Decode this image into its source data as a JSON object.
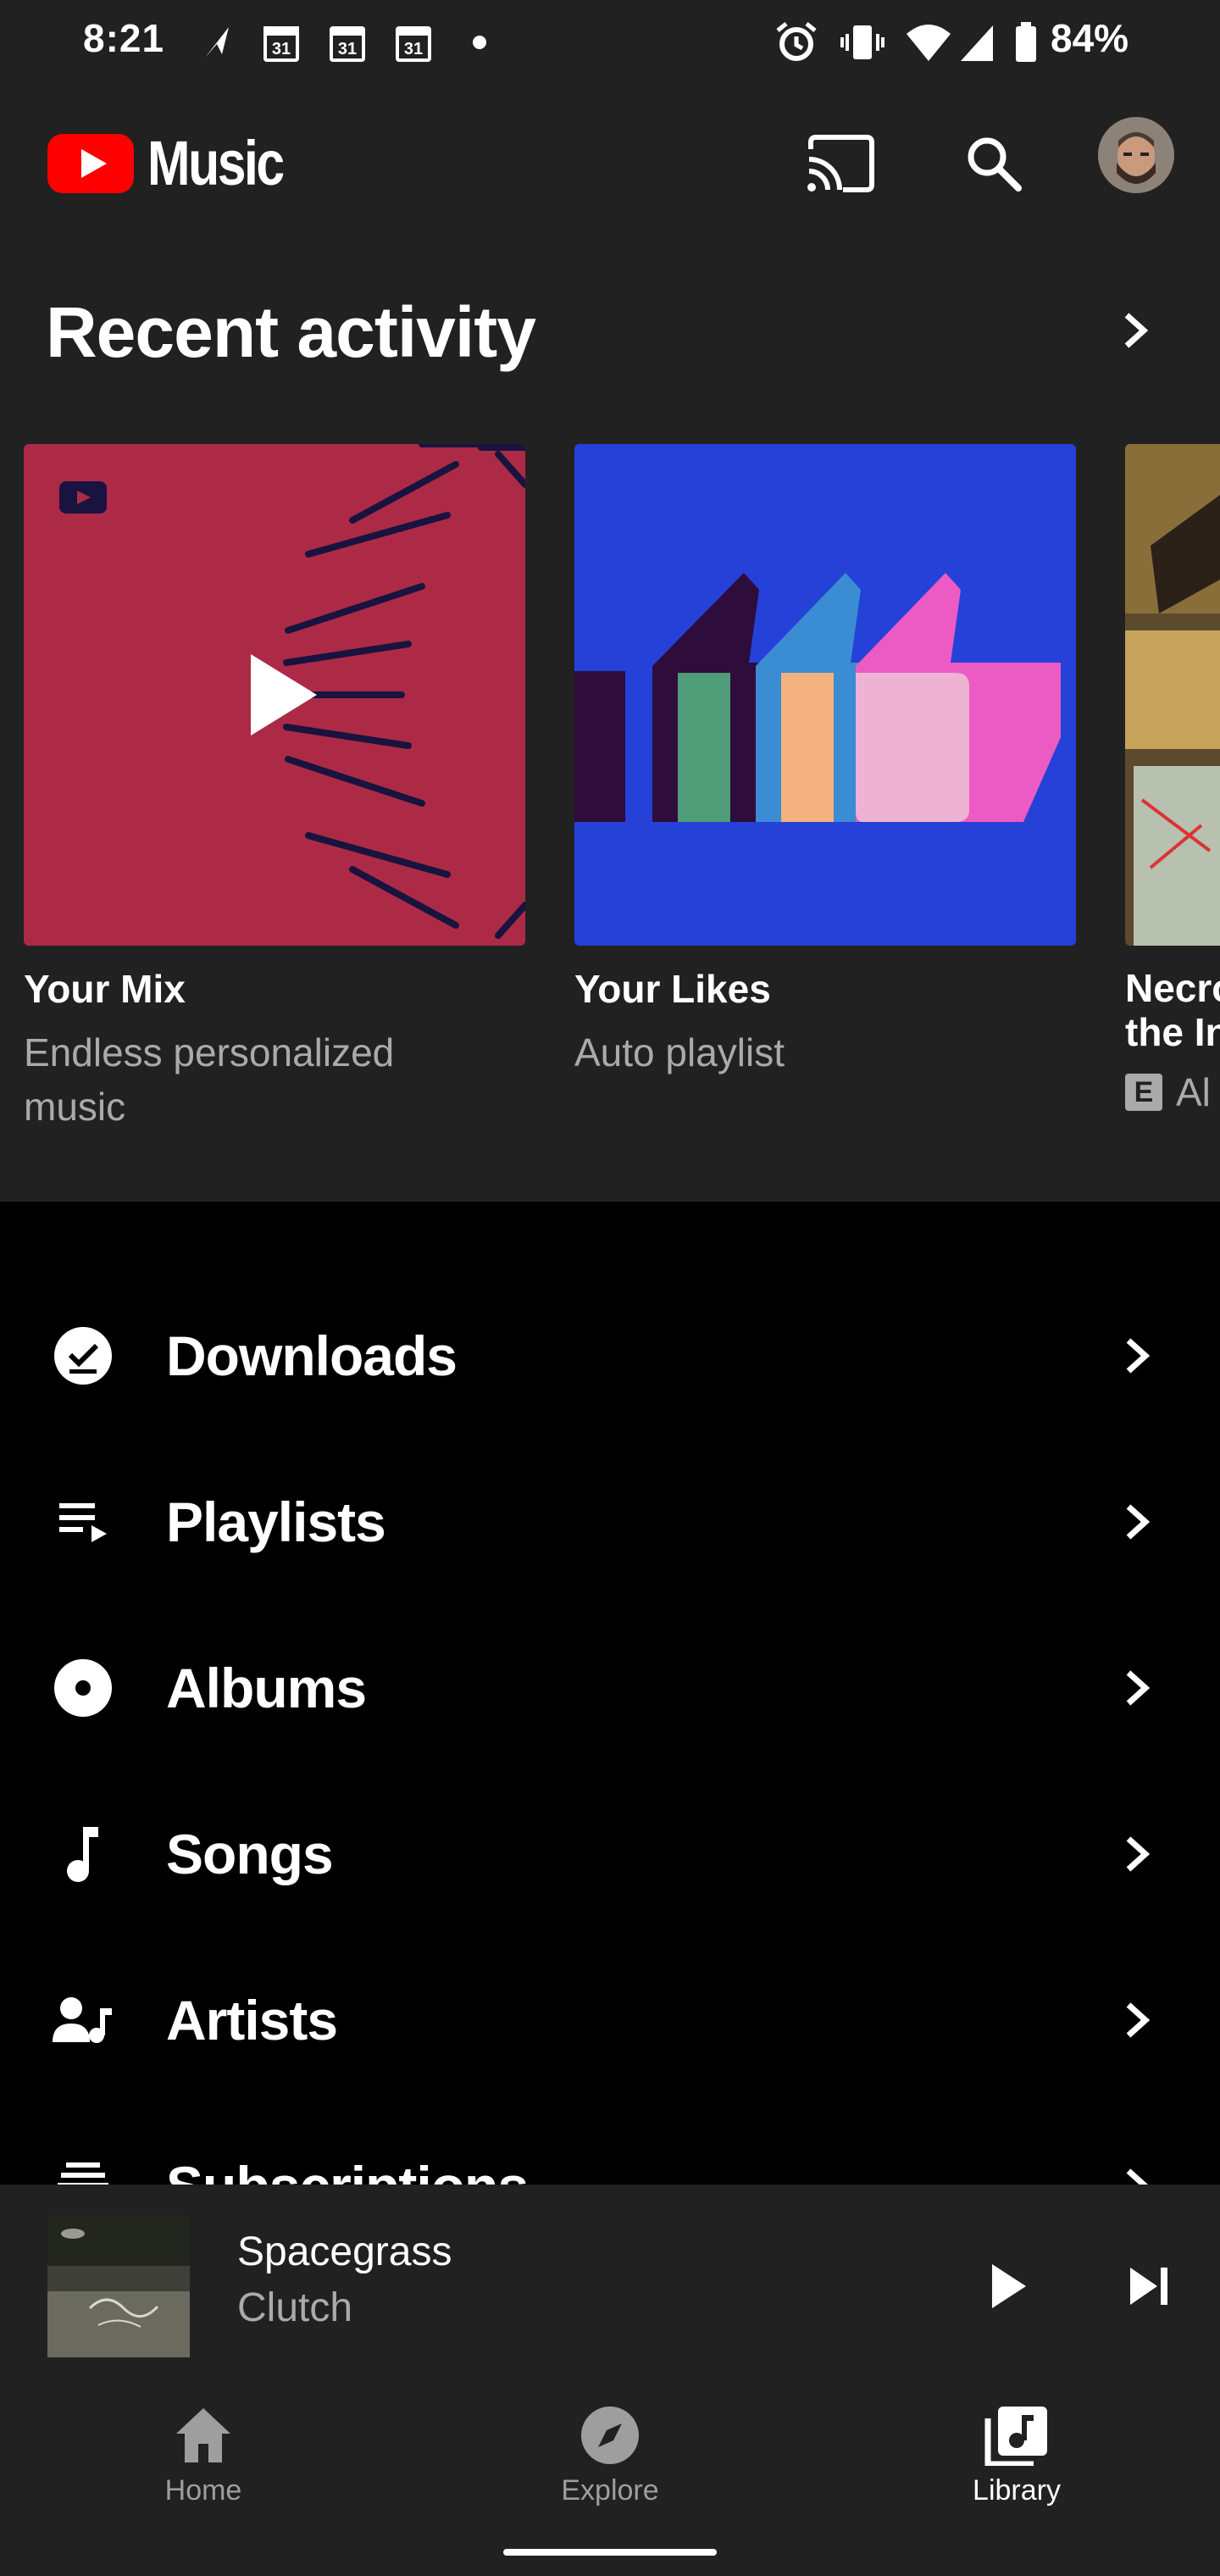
{
  "status_bar": {
    "time": "8:21",
    "calendar_day": "31",
    "battery_percent": "84%"
  },
  "app_bar": {
    "app_name": "Music",
    "brand_color": "#ff0000"
  },
  "recent_activity": {
    "title": "Recent activity",
    "cards": [
      {
        "title": "Your Mix",
        "subtitle": "Endless personalized music"
      },
      {
        "title": "Your Likes",
        "subtitle": "Auto playlist"
      },
      {
        "title": "Necro",
        "title_line2": "the In",
        "badge": "E",
        "subtitle": "Al"
      }
    ]
  },
  "library": {
    "items": [
      {
        "label": "Downloads",
        "icon": "download-check-icon"
      },
      {
        "label": "Playlists",
        "icon": "playlist-icon"
      },
      {
        "label": "Albums",
        "icon": "album-icon"
      },
      {
        "label": "Songs",
        "icon": "music-note-icon"
      },
      {
        "label": "Artists",
        "icon": "artist-icon"
      },
      {
        "label": "Subscriptions",
        "icon": "subscriptions-icon"
      }
    ]
  },
  "now_playing": {
    "title": "Spacegrass",
    "artist": "Clutch"
  },
  "bottom_nav": {
    "items": [
      {
        "label": "Home",
        "icon": "home-icon",
        "active": false
      },
      {
        "label": "Explore",
        "icon": "compass-icon",
        "active": false
      },
      {
        "label": "Library",
        "icon": "library-icon",
        "active": true
      }
    ]
  }
}
